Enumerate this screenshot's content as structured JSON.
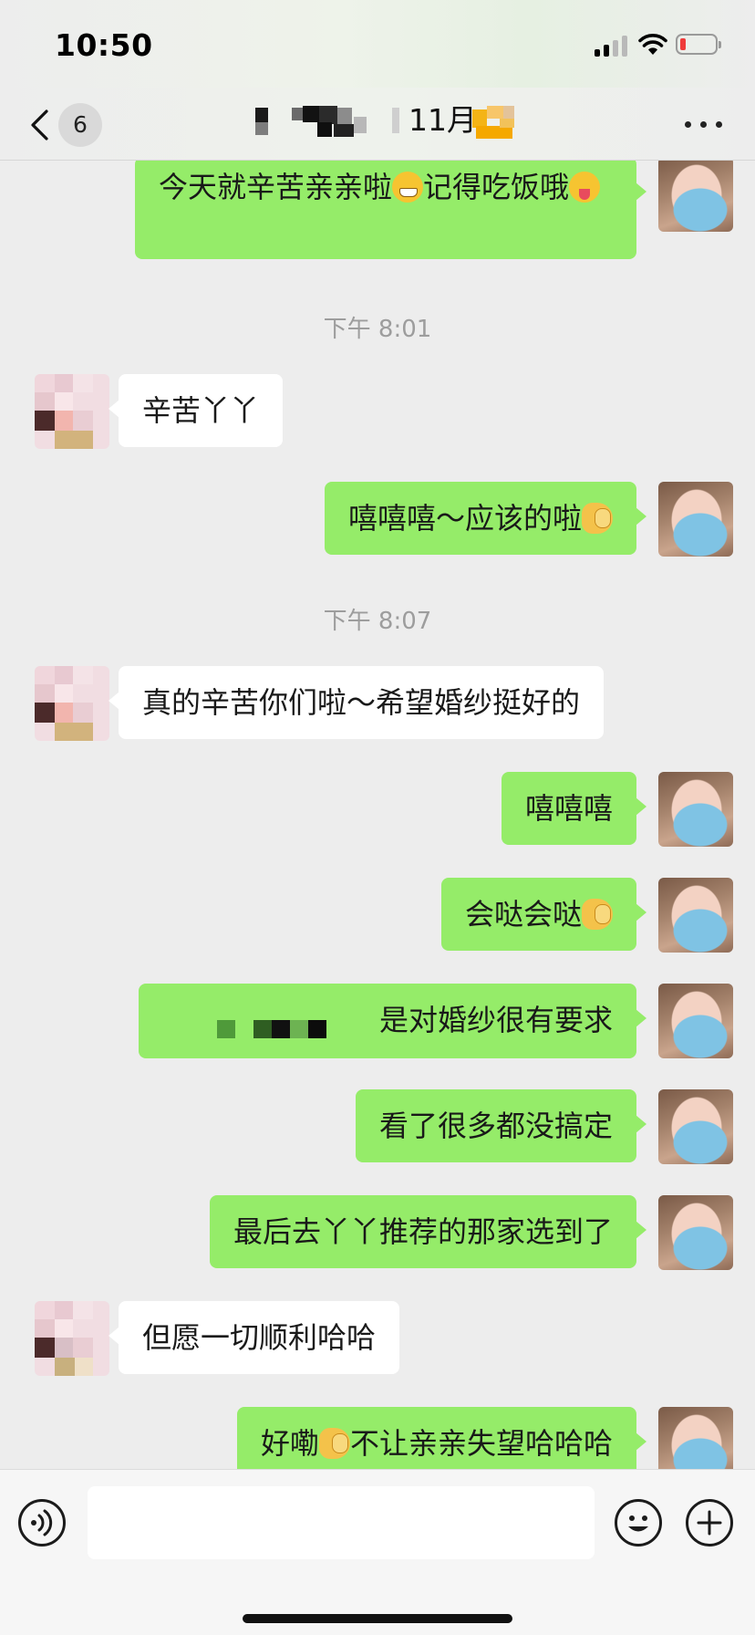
{
  "status_bar": {
    "time": "10:50",
    "signal_icon": "cellular-signal-icon",
    "wifi_icon": "wifi-icon",
    "battery_icon": "battery-low-icon",
    "battery_level": 0.1
  },
  "nav": {
    "back_icon": "chevron-left-icon",
    "unread_count": "6",
    "title_visible_text": "11月",
    "more_icon": "more-dots-icon"
  },
  "messages": [
    {
      "type": "text",
      "side": "out",
      "text": "今天就辛苦亲亲啦😁记得吃饭哦😝"
    },
    {
      "type": "time",
      "text": "下午 8:01"
    },
    {
      "type": "text",
      "side": "in",
      "text": "辛苦丫丫"
    },
    {
      "type": "text",
      "side": "out",
      "text": "嘻嘻嘻～应该的啦🤭"
    },
    {
      "type": "time",
      "text": "下午 8:07"
    },
    {
      "type": "text",
      "side": "in",
      "text": "真的辛苦你们啦～希望婚纱挺好的"
    },
    {
      "type": "text",
      "side": "out",
      "text": "嘻嘻嘻"
    },
    {
      "type": "text",
      "side": "out",
      "text": "会哒会哒🤭"
    },
    {
      "type": "text",
      "side": "out",
      "text": "是对婚纱很有要求"
    },
    {
      "type": "text",
      "side": "out",
      "text": "看了很多都没搞定"
    },
    {
      "type": "text",
      "side": "out",
      "text": "最后去丫丫推荐的那家选到了"
    },
    {
      "type": "text",
      "side": "in",
      "text": "但愿一切顺利哈哈"
    },
    {
      "type": "text",
      "side": "out",
      "text": "好嘞🤭不让亲亲失望哈哈哈"
    }
  ],
  "input_bar": {
    "voice_icon": "voice-input-icon",
    "emoji_icon": "emoji-icon",
    "plus_icon": "plus-icon",
    "message_value": ""
  },
  "colors": {
    "outgoing_bubble": "#95ec69",
    "incoming_bubble": "#ffffff",
    "background": "#ededed",
    "timestamp_text": "#9d9d9d"
  }
}
